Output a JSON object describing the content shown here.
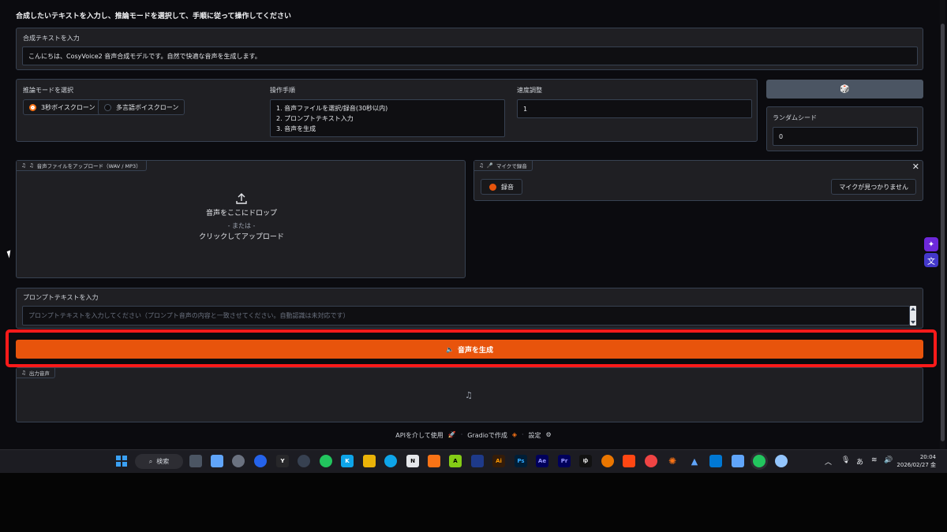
{
  "page_title": "合成したいテキストを入力し、推論モードを選択して、手順に従って操作してください",
  "tts_text": {
    "label": "合成テキストを入力",
    "value": "こんにちは、CosyVoice2 音声合成モデルです。自然で快適な音声を生成します。"
  },
  "mode": {
    "label": "推論モードを選択",
    "options": [
      {
        "label": "3秒ボイスクローン",
        "selected": true
      },
      {
        "label": "多言語ボイスクローン",
        "selected": false
      }
    ]
  },
  "steps": {
    "label": "操作手順",
    "lines": [
      "1. 音声ファイルを選択/録音(30秒以内)",
      "2. プロンプトテキスト入力",
      "3. 音声を生成"
    ]
  },
  "speed": {
    "label": "速度調整",
    "value": "1"
  },
  "dice_button": {
    "icon": "dice-icon",
    "glyph": "🎲"
  },
  "seed": {
    "label": "ランダムシード",
    "value": "0"
  },
  "upload": {
    "tag": "音声ファイルをアップロード（WAV / MP3）",
    "drop_text": "音声をここにドロップ",
    "or_text": "- または -",
    "click_text": "クリックしてアップロード"
  },
  "mic": {
    "tag": "マイクで録音",
    "record_label": "録音",
    "device_label": "マイクが見つかりません"
  },
  "prompt_text": {
    "label": "プロンプトテキストを入力",
    "placeholder": "プロンプトテキストを入力してください（プロンプト音声の内容と一致させてください。自動認識は未対応です）"
  },
  "generate_button": {
    "label": "音声を生成"
  },
  "output": {
    "tag": "出力音声"
  },
  "footer": {
    "api": "APIを介して使用",
    "gradio": "Gradioで作成",
    "settings": "設定",
    "dot": "·"
  },
  "taskbar": {
    "search_label": "検索",
    "ime_label": "あ",
    "time": "20:04",
    "date": "2026/02/27 金"
  },
  "colors": {
    "accent": "#e8540c",
    "highlight": "#ff1a1a",
    "panel": "#1f1f23",
    "background": "#0b0b0f"
  }
}
